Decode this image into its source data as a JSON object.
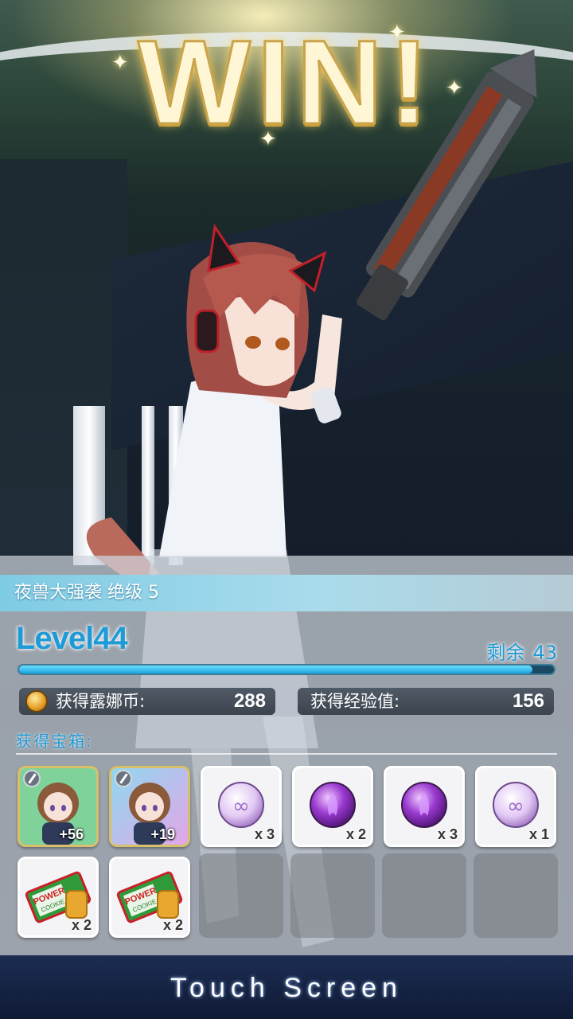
{
  "title": "WIN!",
  "stage": {
    "name": "夜兽大强袭 绝级 5"
  },
  "player": {
    "level": "Level44",
    "remain_label": "剩余",
    "remain_value": "43",
    "exp_progress": 0.96
  },
  "rewards": {
    "coin_label": "获得露娜币:",
    "coin_value": "288",
    "exp_label": "获得经验值:",
    "exp_value": "156",
    "chest_label": "获得宝箱:"
  },
  "items": [
    {
      "kind": "character-card",
      "qty": "+56",
      "bg": "#7fd39a"
    },
    {
      "kind": "character-card",
      "qty": "+19",
      "bg": "#c8b4ea"
    },
    {
      "kind": "light-orb",
      "qty": "x 3",
      "color": "#d8b6f0"
    },
    {
      "kind": "dark-orb",
      "qty": "x 2",
      "color": "#8a2fc4"
    },
    {
      "kind": "dark-orb",
      "qty": "x 3",
      "color": "#8a2fc4"
    },
    {
      "kind": "light-orb",
      "qty": "x 1",
      "color": "#d8b6f0"
    },
    {
      "kind": "power-cookie",
      "qty": "x 2",
      "label": "POWER COOKIE"
    },
    {
      "kind": "power-cookie",
      "qty": "x 2",
      "label": "POWER COOKIE"
    }
  ],
  "footer": {
    "touch_label": "Touch Screen"
  }
}
